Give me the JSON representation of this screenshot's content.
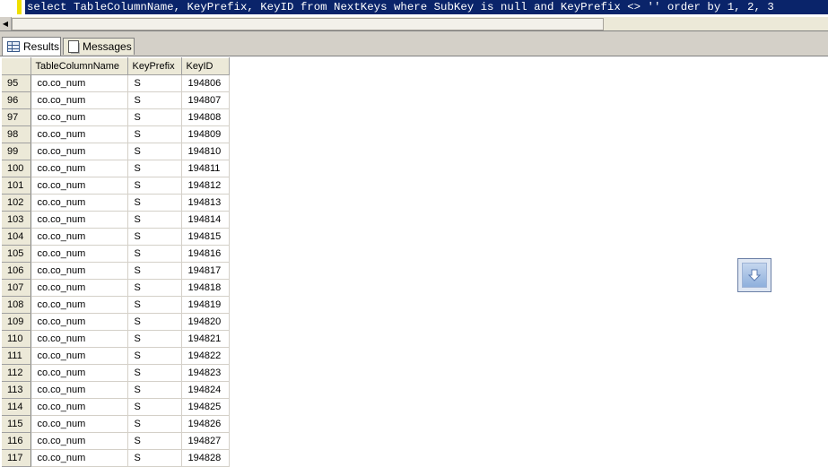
{
  "editor": {
    "query_text": "select TableColumnName, KeyPrefix, KeyID from NextKeys where SubKey is null and KeyPrefix <> '' order by 1, 2, 3"
  },
  "tabs": [
    {
      "label": "Results",
      "icon": "grid-icon",
      "active": true
    },
    {
      "label": "Messages",
      "icon": "messages-icon",
      "active": false
    }
  ],
  "grid": {
    "columns": [
      "TableColumnName",
      "KeyPrefix",
      "KeyID"
    ],
    "rows": [
      {
        "n": "95",
        "table_column_name": "co.co_num",
        "key_prefix": "S",
        "key_id": "194806"
      },
      {
        "n": "96",
        "table_column_name": "co.co_num",
        "key_prefix": "S",
        "key_id": "194807"
      },
      {
        "n": "97",
        "table_column_name": "co.co_num",
        "key_prefix": "S",
        "key_id": "194808"
      },
      {
        "n": "98",
        "table_column_name": "co.co_num",
        "key_prefix": "S",
        "key_id": "194809"
      },
      {
        "n": "99",
        "table_column_name": "co.co_num",
        "key_prefix": "S",
        "key_id": "194810"
      },
      {
        "n": "100",
        "table_column_name": "co.co_num",
        "key_prefix": "S",
        "key_id": "194811"
      },
      {
        "n": "101",
        "table_column_name": "co.co_num",
        "key_prefix": "S",
        "key_id": "194812"
      },
      {
        "n": "102",
        "table_column_name": "co.co_num",
        "key_prefix": "S",
        "key_id": "194813"
      },
      {
        "n": "103",
        "table_column_name": "co.co_num",
        "key_prefix": "S",
        "key_id": "194814"
      },
      {
        "n": "104",
        "table_column_name": "co.co_num",
        "key_prefix": "S",
        "key_id": "194815"
      },
      {
        "n": "105",
        "table_column_name": "co.co_num",
        "key_prefix": "S",
        "key_id": "194816"
      },
      {
        "n": "106",
        "table_column_name": "co.co_num",
        "key_prefix": "S",
        "key_id": "194817"
      },
      {
        "n": "107",
        "table_column_name": "co.co_num",
        "key_prefix": "S",
        "key_id": "194818"
      },
      {
        "n": "108",
        "table_column_name": "co.co_num",
        "key_prefix": "S",
        "key_id": "194819"
      },
      {
        "n": "109",
        "table_column_name": "co.co_num",
        "key_prefix": "S",
        "key_id": "194820"
      },
      {
        "n": "110",
        "table_column_name": "co.co_num",
        "key_prefix": "S",
        "key_id": "194821"
      },
      {
        "n": "111",
        "table_column_name": "co.co_num",
        "key_prefix": "S",
        "key_id": "194822"
      },
      {
        "n": "112",
        "table_column_name": "co.co_num",
        "key_prefix": "S",
        "key_id": "194823"
      },
      {
        "n": "113",
        "table_column_name": "co.co_num",
        "key_prefix": "S",
        "key_id": "194824"
      },
      {
        "n": "114",
        "table_column_name": "co.co_num",
        "key_prefix": "S",
        "key_id": "194825"
      },
      {
        "n": "115",
        "table_column_name": "co.co_num",
        "key_prefix": "S",
        "key_id": "194826"
      },
      {
        "n": "116",
        "table_column_name": "co.co_num",
        "key_prefix": "S",
        "key_id": "194827"
      },
      {
        "n": "117",
        "table_column_name": "co.co_num",
        "key_prefix": "S",
        "key_id": "194828"
      }
    ]
  },
  "colors": {
    "selection_bg": "#0a246a",
    "chrome": "#d4d0c8",
    "header_bg": "#ece9d8"
  },
  "icons": {
    "scroll_button": "scroll-down-icon",
    "scroll_left": "arrow-left-icon"
  }
}
